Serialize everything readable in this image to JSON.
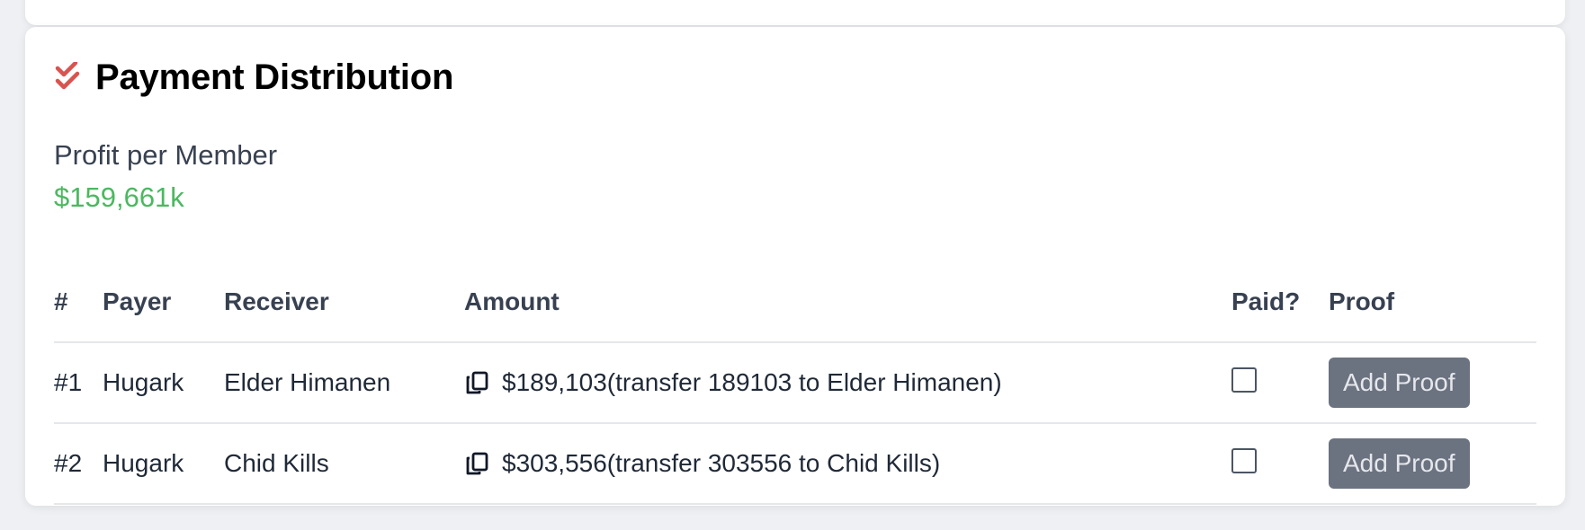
{
  "section": {
    "title": "Payment Distribution",
    "icon": "double-check-icon",
    "accent_color": "#d9534f"
  },
  "profit": {
    "label": "Profit per Member",
    "value": "$159,661k",
    "value_color": "#4cb860"
  },
  "table": {
    "headers": [
      "#",
      "Payer",
      "Receiver",
      "Amount",
      "Paid?",
      "Proof"
    ],
    "rows": [
      {
        "num": "#1",
        "payer": "Hugark",
        "receiver": "Elder Himanen",
        "amount": "$189,103(transfer 189103 to Elder Himanen)",
        "paid": false,
        "proof_button": "Add Proof"
      },
      {
        "num": "#2",
        "payer": "Hugark",
        "receiver": "Chid Kills",
        "amount": "$303,556(transfer 303556 to Chid Kills)",
        "paid": false,
        "proof_button": "Add Proof"
      }
    ]
  }
}
